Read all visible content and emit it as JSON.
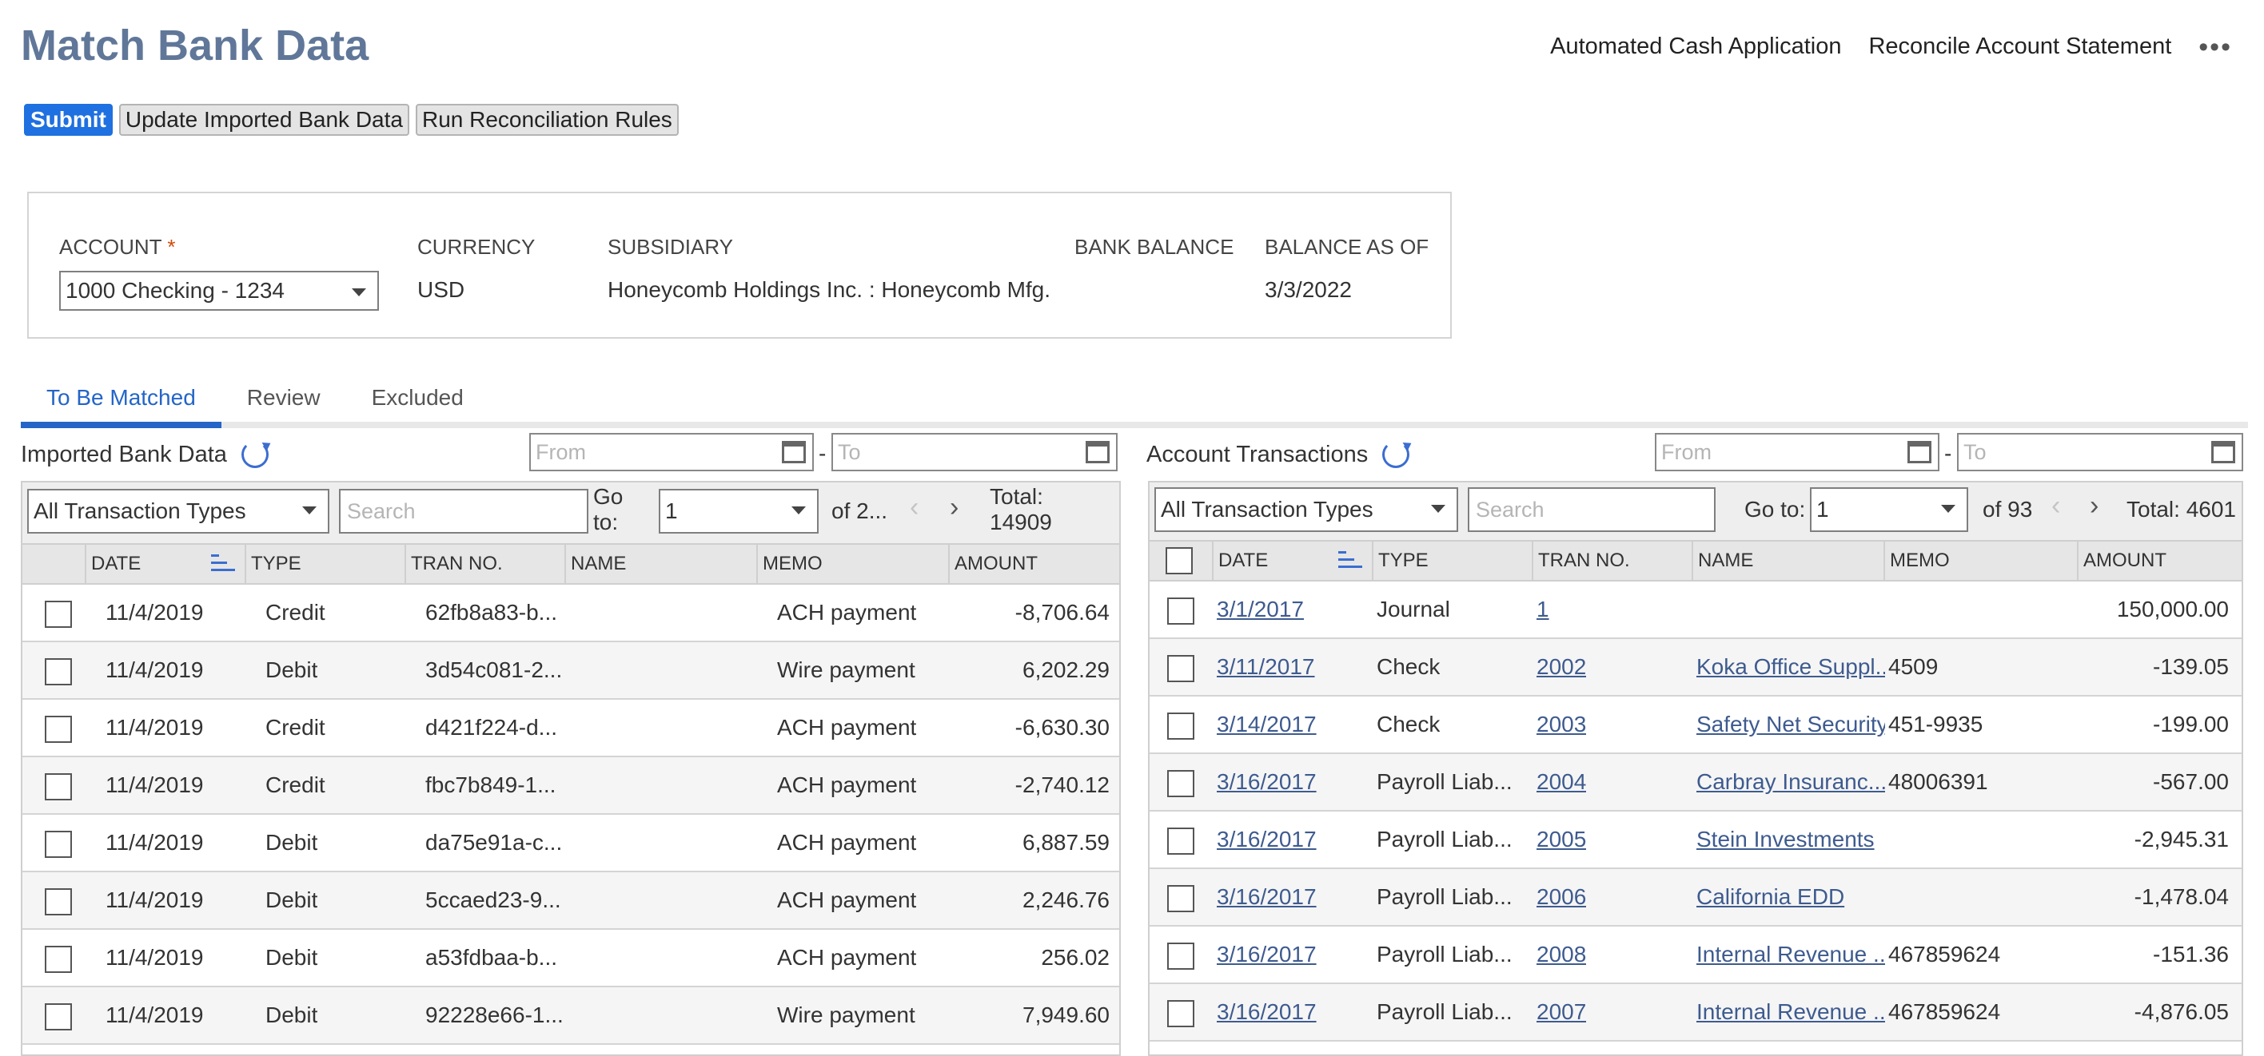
{
  "page_title": "Match Bank Data",
  "top_links": {
    "automated": "Automated Cash Application",
    "reconcile": "Reconcile Account Statement",
    "more": "•••"
  },
  "toolbar": {
    "submit": "Submit",
    "update": "Update Imported Bank Data",
    "run": "Run Reconciliation Rules"
  },
  "account_info": {
    "account_label": "ACCOUNT",
    "required_mark": "*",
    "account_value": "1000 Checking - 1234",
    "currency_label": "CURRENCY",
    "currency_value": "USD",
    "subsidiary_label": "SUBSIDIARY",
    "subsidiary_value": "Honeycomb Holdings Inc. : Honeycomb Mfg.",
    "bank_balance_label": "BANK BALANCE",
    "bank_balance_value": "",
    "balance_as_of_label": "BALANCE AS OF",
    "balance_as_of_value": "3/3/2022"
  },
  "tabs": [
    {
      "label": "To Be Matched"
    },
    {
      "label": "Review"
    },
    {
      "label": "Excluded"
    }
  ],
  "left_panel": {
    "title": "Imported Bank Data",
    "from_placeholder": "From",
    "to_placeholder": "To",
    "dash": "-",
    "type_filter": "All Transaction Types",
    "search_placeholder": "Search",
    "go_to_label_1": "Go",
    "go_to_label_2": "to:",
    "page": "1",
    "of_pages": "of 2...",
    "total_label": "Total:",
    "total_value": "14909",
    "columns": {
      "date": "DATE",
      "type": "TYPE",
      "tran_no": "TRAN NO.",
      "name": "NAME",
      "memo": "MEMO",
      "amount": "AMOUNT"
    },
    "rows": [
      {
        "date": "11/4/2019",
        "type": "Credit",
        "tran_no": "62fb8a83-b...",
        "name": "",
        "memo": "ACH payment",
        "amount": "-8,706.64"
      },
      {
        "date": "11/4/2019",
        "type": "Debit",
        "tran_no": "3d54c081-2...",
        "name": "",
        "memo": "Wire payment",
        "amount": "6,202.29"
      },
      {
        "date": "11/4/2019",
        "type": "Credit",
        "tran_no": "d421f224-d...",
        "name": "",
        "memo": "ACH payment",
        "amount": "-6,630.30"
      },
      {
        "date": "11/4/2019",
        "type": "Credit",
        "tran_no": "fbc7b849-1...",
        "name": "",
        "memo": "ACH payment",
        "amount": "-2,740.12"
      },
      {
        "date": "11/4/2019",
        "type": "Debit",
        "tran_no": "da75e91a-c...",
        "name": "",
        "memo": "ACH payment",
        "amount": "6,887.59"
      },
      {
        "date": "11/4/2019",
        "type": "Debit",
        "tran_no": "5ccaed23-9...",
        "name": "",
        "memo": "ACH payment",
        "amount": "2,246.76"
      },
      {
        "date": "11/4/2019",
        "type": "Debit",
        "tran_no": "a53fdbaa-b...",
        "name": "",
        "memo": "ACH payment",
        "amount": "256.02"
      },
      {
        "date": "11/4/2019",
        "type": "Debit",
        "tran_no": "92228e66-1...",
        "name": "",
        "memo": "Wire payment",
        "amount": "7,949.60"
      }
    ]
  },
  "right_panel": {
    "title": "Account Transactions",
    "from_placeholder": "From",
    "to_placeholder": "To",
    "dash": "-",
    "type_filter": "All Transaction Types",
    "search_placeholder": "Search",
    "go_to_label": "Go to:",
    "page": "1",
    "of_pages": "of 93",
    "total": "Total: 4601",
    "columns": {
      "date": "DATE",
      "type": "TYPE",
      "tran_no": "TRAN NO.",
      "name": "NAME",
      "memo": "MEMO",
      "amount": "AMOUNT"
    },
    "rows": [
      {
        "date": "3/1/2017",
        "type": "Journal",
        "tran_no": "1",
        "name": "",
        "memo": "",
        "amount": "150,000.00"
      },
      {
        "date": "3/11/2017",
        "type": "Check",
        "tran_no": "2002",
        "name": "Koka Office Suppl...",
        "memo": "4509",
        "amount": "-139.05"
      },
      {
        "date": "3/14/2017",
        "type": "Check",
        "tran_no": "2003",
        "name": "Safety Net Security",
        "memo": "451-9935",
        "amount": "-199.00"
      },
      {
        "date": "3/16/2017",
        "type": "Payroll Liab...",
        "tran_no": "2004",
        "name": "Carbray Insuranc...",
        "memo": "48006391",
        "amount": "-567.00"
      },
      {
        "date": "3/16/2017",
        "type": "Payroll Liab...",
        "tran_no": "2005",
        "name": "Stein Investments",
        "memo": "",
        "amount": "-2,945.31"
      },
      {
        "date": "3/16/2017",
        "type": "Payroll Liab...",
        "tran_no": "2006",
        "name": "California EDD",
        "memo": "",
        "amount": "-1,478.04"
      },
      {
        "date": "3/16/2017",
        "type": "Payroll Liab...",
        "tran_no": "2008",
        "name": "Internal Revenue ...",
        "memo": "467859624",
        "amount": "-151.36"
      },
      {
        "date": "3/16/2017",
        "type": "Payroll Liab...",
        "tran_no": "2007",
        "name": "Internal Revenue ...",
        "memo": "467859624",
        "amount": "-4,876.05"
      }
    ]
  }
}
